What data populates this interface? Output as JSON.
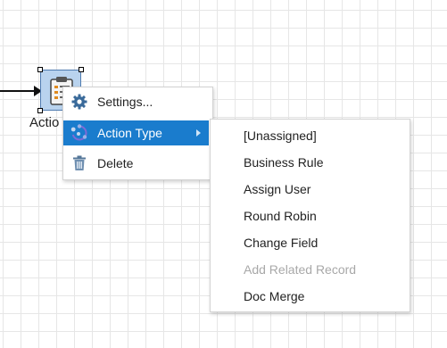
{
  "diagram": {
    "node_label": "Actio",
    "node_icon": "checklist-icon"
  },
  "context_menu": {
    "items": [
      {
        "label": "Settings...",
        "icon": "gear-icon"
      },
      {
        "label": "Action Type",
        "icon": "action-type-icon",
        "active": true,
        "has_submenu": true
      },
      {
        "label": "Delete",
        "icon": "trash-icon"
      }
    ]
  },
  "submenu": {
    "items": [
      {
        "label": "[Unassigned]",
        "enabled": true
      },
      {
        "label": "Business Rule",
        "enabled": true
      },
      {
        "label": "Assign User",
        "enabled": true
      },
      {
        "label": "Round Robin",
        "enabled": true
      },
      {
        "label": "Change Field",
        "enabled": true
      },
      {
        "label": "Add Related Record",
        "enabled": false
      },
      {
        "label": "Doc Merge",
        "enabled": true
      }
    ]
  },
  "colors": {
    "highlight": "#1a7ccd",
    "node_fill": "#b9d3ee",
    "disabled_text": "#a8a8a8"
  }
}
